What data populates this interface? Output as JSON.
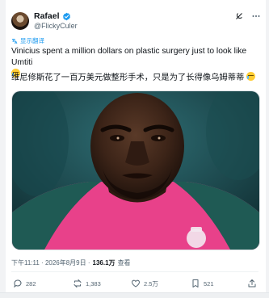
{
  "post": {
    "author": {
      "name": "Rafael",
      "handle": "@FlickyCuler",
      "verified_color": "#1d9bf0"
    },
    "translate_label": "显示翻译",
    "text": "Vinicius spent a million dollars on plastic surgery just to look like Umtiti",
    "text_emoji": "crying-face-icon",
    "translation": "维尼修斯花了一百万美元做整形手术，只是为了长得像乌姆蒂蒂",
    "translation_emoji": "crying-face-icon",
    "timestamp": "下午11:11 · 2026年8月9日 ·",
    "views_count": "136.1万",
    "views_label": "查看"
  },
  "actions": {
    "replies": "282",
    "reposts": "1,383",
    "likes": "2.5万",
    "bookmarks": "521"
  },
  "colors": {
    "accent": "#1d9bf0",
    "secondary_text": "#536471",
    "jersey_pink": "#e8418a",
    "jersey_teal": "#1f5a54"
  }
}
